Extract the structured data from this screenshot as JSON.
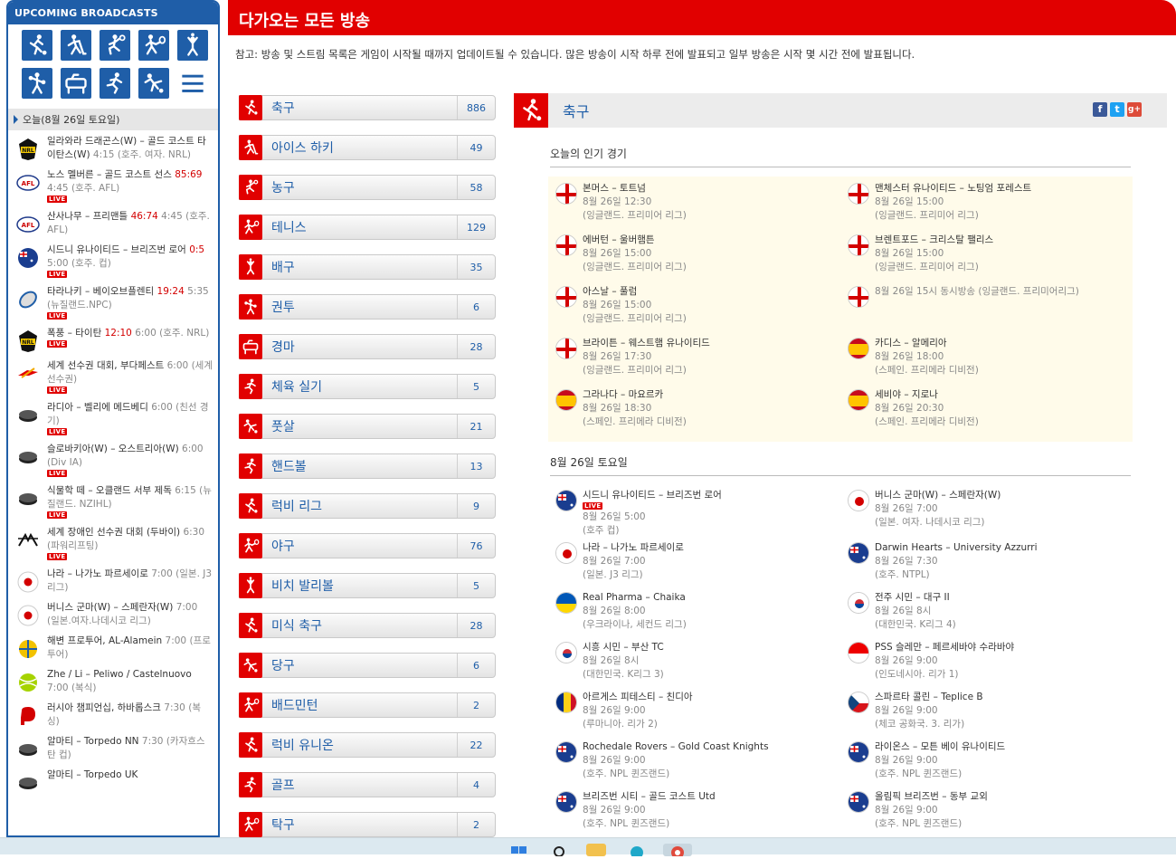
{
  "sidebar": {
    "title": "UPCOMING BROADCASTS",
    "sport_icons": [
      "soccer-icon",
      "hockey-icon",
      "basketball-icon",
      "tennis-icon",
      "volleyball-icon",
      "boxing-icon",
      "horse-racing-icon",
      "athletics-icon",
      "futsal-icon",
      "menu-icon"
    ],
    "today_label": "오늘(8월 26일 토요일)",
    "broadcasts": [
      {
        "logo": "nrl-logo",
        "title": "일라와라 드래곤스(W) – 골드 코스트 타이탄스(W)",
        "score": "",
        "time": "4:15",
        "meta": "(호주. 여자. NRL)",
        "live": false
      },
      {
        "logo": "afl-logo",
        "title": "노스 멜버른 – 골드 코스트 선스",
        "score": "85:69",
        "time": "4:45",
        "meta": "(호주. AFL)",
        "live": true
      },
      {
        "logo": "afl-logo",
        "title": "산사나무 – 프리맨틀",
        "score": "46:74",
        "time": "4:45",
        "meta": "(호주. AFL)",
        "live": false
      },
      {
        "logo": "aus-flag",
        "title": "시드니 유나이티드 – 브리즈번 로어",
        "score": "0:5",
        "time": "5:00",
        "meta": "(호주. 컵)",
        "live": true
      },
      {
        "logo": "rugby-ball",
        "title": "타라나키 – 베이오브플렌티",
        "score": "19:24",
        "time": "5:35",
        "meta": "(뉴질랜드.NPC)",
        "live": true
      },
      {
        "logo": "nrl-logo",
        "title": "폭풍 – 타이탄",
        "score": "12:10",
        "time": "6:00",
        "meta": "(호주. NRL)",
        "live": true
      },
      {
        "logo": "athletics-logo",
        "title": "세계 선수권 대회, 부다페스트",
        "score": "",
        "time": "6:00",
        "meta": "(세계 선수권)",
        "live": true
      },
      {
        "logo": "puck",
        "title": "라디아 – 벨리에 메드베디",
        "score": "",
        "time": "6:00",
        "meta": "(친선 경기)",
        "live": true
      },
      {
        "logo": "puck",
        "title": "슬로바키아(W) – 오스트리아(W)",
        "score": "",
        "time": "6:00",
        "meta": "(Div IA)",
        "live": true
      },
      {
        "logo": "puck",
        "title": "식물학 떼 – 오클랜드 서부 제독",
        "score": "",
        "time": "6:15",
        "meta": "(뉴질랜드. NZIHL)",
        "live": true
      },
      {
        "logo": "powerlifting-logo",
        "title": "세계 장애인 선수권 대회 (두바이)",
        "score": "",
        "time": "6:30",
        "meta": "(파워리프팅)",
        "live": true
      },
      {
        "logo": "jp-flag",
        "title": "나라 – 나가노 파르세이로",
        "score": "",
        "time": "7:00",
        "meta": "(일본. J3 리그)",
        "live": false
      },
      {
        "logo": "jp-flag",
        "title": "버니스 군마(W) – 스페란자(W)",
        "score": "",
        "time": "7:00",
        "meta": "(일본.여자.나데시코 리그)",
        "live": false
      },
      {
        "logo": "beach-ball",
        "title": "해변 프로투어, AL-Alamein",
        "score": "",
        "time": "7:00",
        "meta": "(프로투어)",
        "live": false
      },
      {
        "logo": "tennis-ball",
        "title": "Zhe / Li – Peliwo / Castelnuovo",
        "score": "",
        "time": "7:00",
        "meta": "(복식)",
        "live": false
      },
      {
        "logo": "boxing-glove",
        "title": "러시아 챔피언십, 하바롭스크",
        "score": "",
        "time": "7:30",
        "meta": "(복싱)",
        "live": false
      },
      {
        "logo": "puck",
        "title": "알마티 – Torpedo NN",
        "score": "",
        "time": "7:30",
        "meta": "(카자흐스탄 컵)",
        "live": false
      },
      {
        "logo": "puck",
        "title": "알마티 – Torpedo UK",
        "score": "",
        "time": "",
        "meta": "",
        "live": false
      }
    ]
  },
  "header": {
    "title": "다가오는 모든 방송",
    "notice": "참고: 방송 및 스트림 목록은 게임이 시작될 때까지 업데이트될 수 있습니다. 많은 방송이 시작 하루 전에 발표되고 일부 방송은 시작 몇 시간 전에 발표됩니다."
  },
  "sports": [
    {
      "name": "축구",
      "count": "886"
    },
    {
      "name": "아이스 하키",
      "count": "49"
    },
    {
      "name": "농구",
      "count": "58"
    },
    {
      "name": "테니스",
      "count": "129"
    },
    {
      "name": "배구",
      "count": "35"
    },
    {
      "name": "권투",
      "count": "6"
    },
    {
      "name": "경마",
      "count": "28"
    },
    {
      "name": "체육 실기",
      "count": "5"
    },
    {
      "name": "풋살",
      "count": "21"
    },
    {
      "name": "핸드볼",
      "count": "13"
    },
    {
      "name": "럭비 리그",
      "count": "9"
    },
    {
      "name": "야구",
      "count": "76"
    },
    {
      "name": "비치 발리볼",
      "count": "5"
    },
    {
      "name": "미식 축구",
      "count": "28"
    },
    {
      "name": "당구",
      "count": "6"
    },
    {
      "name": "배드민턴",
      "count": "2"
    },
    {
      "name": "럭비 유니온",
      "count": "22"
    },
    {
      "name": "골프",
      "count": "4"
    },
    {
      "name": "탁구",
      "count": "2"
    }
  ],
  "main": {
    "title": "축구",
    "share": [
      "f",
      "t",
      "g+"
    ],
    "popular_title": "오늘의 인기 경기",
    "popular": [
      {
        "flag": "eng",
        "title": "본머스 – 토트넘",
        "date": "8월 26일 12:30",
        "league": "(잉글랜드. 프리미어 리그)"
      },
      {
        "flag": "eng",
        "title": "맨체스터 유나이티드 – 노팅엄 포레스트",
        "date": "8월 26일 15:00",
        "league": "(잉글랜드. 프리미어 리그)"
      },
      {
        "flag": "eng",
        "title": "에버턴 – 울버햄튼",
        "date": "8월 26일 15:00",
        "league": "(잉글랜드. 프리미어 리그)"
      },
      {
        "flag": "eng",
        "title": "브렌트포드 – 크리스탈 팰리스",
        "date": "8월 26일 15:00",
        "league": "(잉글랜드. 프리미어 리그)"
      },
      {
        "flag": "eng",
        "title": "아스날 – 풀럼",
        "date": "8월 26일 15:00",
        "league": "(잉글랜드. 프리미어 리그)"
      },
      {
        "flag": "eng",
        "title": "",
        "date": "8월 26일 15시 동시방송",
        "league": "(잉글랜드. 프리미어리그)",
        "inline": true
      },
      {
        "flag": "eng",
        "title": "브라이튼 – 웨스트햄 유나이티드",
        "date": "8월 26일 17:30",
        "league": "(잉글랜드. 프리미어 리그)"
      },
      {
        "flag": "esp",
        "title": "카디스 – 알메리아",
        "date": "8월 26일 18:00",
        "league": "(스페인. 프리메라 디비전)"
      },
      {
        "flag": "esp",
        "title": "그라나다 – 마요르카",
        "date": "8월 26일 18:30",
        "league": "(스페인. 프리메라 디비전)"
      },
      {
        "flag": "esp",
        "title": "세비야 – 지로나",
        "date": "8월 26일 20:30",
        "league": "(스페인. 프리메라 디비전)"
      }
    ],
    "day_title": "8월 26일 토요일",
    "day_matches": [
      {
        "flag": "aus",
        "title": "시드니 유나이티드 – 브리즈번 로어",
        "date": "8월 26일 5:00",
        "league": "(호주 컵)",
        "live": true
      },
      {
        "flag": "jpn",
        "title": "버니스 군마(W) – 스페란자(W)",
        "date": "8월 26일 7:00",
        "league": "(일본. 여자. 나데시코 리그)",
        "live": false
      },
      {
        "flag": "jpn",
        "title": "나라 – 나가노 파르세이로",
        "date": "8월 26일 7:00",
        "league": "(일본. J3 리그)",
        "live": false
      },
      {
        "flag": "aus",
        "title": "Darwin Hearts – University Azzurri",
        "date": "8월 26일 7:30",
        "league": "(호주. NTPL)",
        "live": false
      },
      {
        "flag": "ukr",
        "title": "Real Pharma – Chaika",
        "date": "8월 26일 8:00",
        "league": "(우크라이나, 세컨드 리그)",
        "live": false
      },
      {
        "flag": "kor",
        "title": "전주 시민 – 대구 II",
        "date": "8월 26일 8시",
        "league": "(대한민국. K리그 4)",
        "live": false
      },
      {
        "flag": "kor",
        "title": "시흥 시민 – 부산 TC",
        "date": "8월 26일 8시",
        "league": "(대한민국. K리그 3)",
        "live": false
      },
      {
        "flag": "idn",
        "title": "PSS 슬레만 – 페르세바야 수라바야",
        "date": "8월 26일 9:00",
        "league": "(인도네시아. 리가 1)",
        "live": false
      },
      {
        "flag": "rou",
        "title": "아르게스 피테스티 – 친디아",
        "date": "8월 26일 9:00",
        "league": "(루마니아. 리가 2)",
        "live": false
      },
      {
        "flag": "cze",
        "title": "스파르타 콜린 – Teplice B",
        "date": "8월 26일 9:00",
        "league": "(체코 공화국. 3. 리가)",
        "live": false
      },
      {
        "flag": "aus",
        "title": "Rochedale Rovers – Gold Coast Knights",
        "date": "8월 26일 9:00",
        "league": "(호주. NPL 퀸즈랜드)",
        "live": false
      },
      {
        "flag": "aus",
        "title": "라이온스 – 모튼 베이 유나이티드",
        "date": "8월 26일 9:00",
        "league": "(호주. NPL 퀸즈랜드)",
        "live": false
      },
      {
        "flag": "aus",
        "title": "브리즈번 시티 – 골드 코스트 Utd",
        "date": "8월 26일 9:00",
        "league": "(호주. NPL 퀸즈랜드)",
        "live": false
      },
      {
        "flag": "aus",
        "title": "올림픽 브리즈번 – 동부 교외",
        "date": "8월 26일 9:00",
        "league": "(호주. NPL 퀸즈랜드)",
        "live": false
      }
    ]
  },
  "colors": {
    "accent_red": "#e10000",
    "brand_blue": "#1f5ea8",
    "popular_bg": "#fffbea"
  }
}
